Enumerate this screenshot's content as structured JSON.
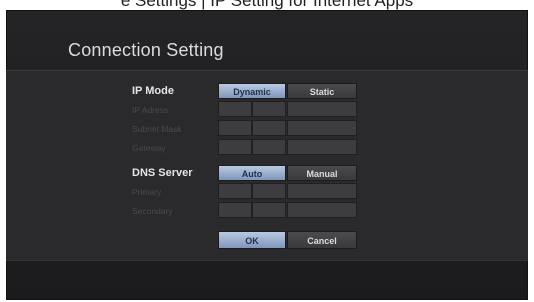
{
  "header_fragment": "e Settings | IP Setting for Internet Apps",
  "title": "Connection Setting",
  "ip_mode": {
    "label": "IP Mode",
    "options": [
      "Dynamic",
      "Static"
    ],
    "selected": "Dynamic"
  },
  "ip_fields": {
    "ip_address_label": "IP Adress",
    "subnet_label": "Subnet Mask",
    "gateway_label": "Gateway"
  },
  "dns": {
    "label": "DNS Server",
    "options": [
      "Auto",
      "Manual"
    ],
    "selected": "Auto",
    "primary_label": "Primary",
    "secondary_label": "Secondary"
  },
  "actions": {
    "ok_label": "OK",
    "cancel_label": "Cancel"
  },
  "colors": {
    "selected_button": "#9fb3d2",
    "screen_bg": "#1f1f21"
  }
}
